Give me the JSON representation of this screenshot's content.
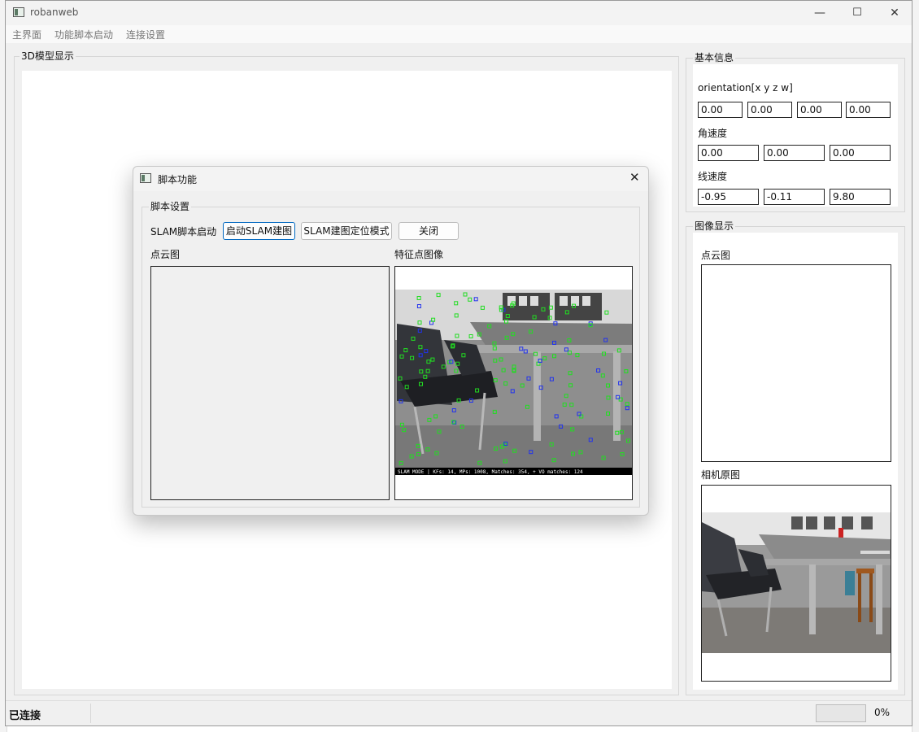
{
  "window": {
    "title": "robanweb",
    "minimize": "—",
    "maximize": "☐",
    "close": "✕"
  },
  "menu": [
    "主界面",
    "功能脚本启动",
    "连接设置"
  ],
  "model_panel": {
    "title": "3D模型显示"
  },
  "basic_info": {
    "title": "基本信息",
    "orientation_label": "orientation[x  y  z  w]",
    "orientation": [
      "0.00",
      "0.00",
      "0.00",
      "0.00"
    ],
    "angular_label": "角速度",
    "angular": [
      "0.00",
      "0.00",
      "0.00"
    ],
    "linear_label": "线速度",
    "linear": [
      "-0.95",
      "-0.11",
      "9.80"
    ]
  },
  "image_display": {
    "title": "图像显示",
    "pointcloud_label": "点云图",
    "camera_label": "相机原图"
  },
  "status": {
    "connection": "已连接",
    "progress_text": "0%",
    "progress_value": 0
  },
  "dialog": {
    "title": "脚本功能",
    "close": "✕",
    "group_title": "脚本设置",
    "slam_label": "SLAM脚本启动",
    "start_mapping_button": "启动SLAM建图",
    "localization_button": "SLAM建图定位模式",
    "close_button": "关闭",
    "pointcloud_label": "点云图",
    "feature_label": "特征点图像",
    "slam_overlay": "SLAM MODE |  KFs: 14, MPs: 1008, Matches: 354, + VO matches: 124"
  },
  "colors": {
    "feature_green": "#22dd22",
    "feature_blue": "#2233ee",
    "focus_border": "#0067c0"
  }
}
